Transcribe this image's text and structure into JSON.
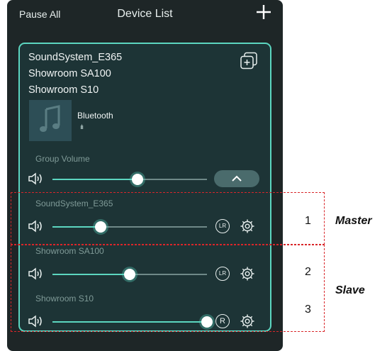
{
  "header": {
    "pause_all": "Pause All",
    "title": "Device List",
    "add_icon": "plus-icon"
  },
  "group": {
    "devices": [
      "SoundSystem_E365",
      "Showroom SA100",
      "Showroom S10"
    ],
    "source": "Bluetooth",
    "eq_glyph": "ılı",
    "volume_label": "Group Volume",
    "volume": 0.55
  },
  "speakers": [
    {
      "name": "SoundSystem_E365",
      "channel": "LR",
      "volume": 0.31
    },
    {
      "name": "Showroom SA100",
      "channel": "LR",
      "volume": 0.5
    },
    {
      "name": "Showroom S10",
      "channel": "R",
      "volume": 1.0
    }
  ],
  "annotations": {
    "n1": "1",
    "n2": "2",
    "n3": "3",
    "master": "Master",
    "slave": "Slave"
  },
  "colors": {
    "accent": "#5cd6c0",
    "panel": "#1e2627",
    "card": "#1d3436",
    "marker": "#d9262a"
  }
}
